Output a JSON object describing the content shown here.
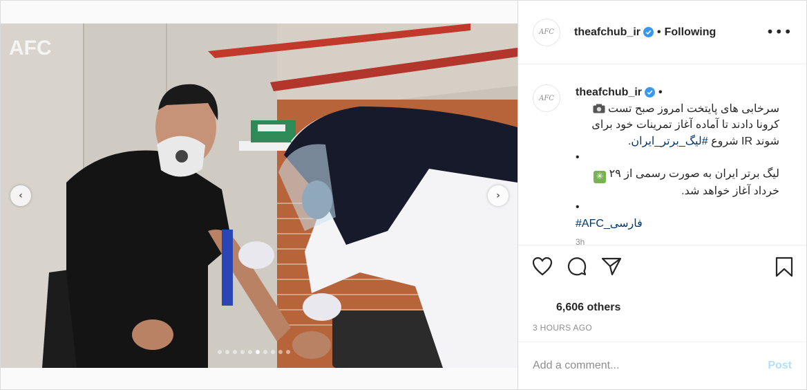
{
  "account": {
    "username": "theafchub_ir",
    "avatar_text": "AFC",
    "follow_status": "Following",
    "separator": "•"
  },
  "photo": {
    "watermark": "AFC",
    "carousel": {
      "total": 10,
      "active_index": 5
    }
  },
  "caption": {
    "username": "theafchub_ir",
    "separator": "•",
    "line1": "سرخابی های پایتخت امروز صبح تست",
    "line2": "کرونا دادند تا آماده آغاز تمرینات خود برای",
    "line3_prefix": "شوند ",
    "line3_flag": "IR",
    "line3_word": " شروع ",
    "line3_hashtag": "#لیگ_برتر_ایران",
    "line3_end": ".",
    "bullet1": "•",
    "line4_emoji": "✳",
    "line4_text": " لیگ برتر ایران به صورت رسمی از ۲۹",
    "line5": "خرداد آغاز خواهد شد.",
    "bullet2": "•",
    "hashtag_line": "#AFC_فارسی",
    "time": "3h"
  },
  "actions": {
    "icons": [
      "heart-icon",
      "comment-icon",
      "share-icon",
      "bookmark-icon"
    ],
    "likes_text": "6,606 others",
    "posted": "3 HOURS AGO"
  },
  "comment": {
    "placeholder": "Add a comment...",
    "post_label": "Post"
  },
  "colors": {
    "verified": "#3897f0",
    "link": "#00376b",
    "post_button_disabled": "#b2dffc",
    "border": "#dbdbdb"
  }
}
